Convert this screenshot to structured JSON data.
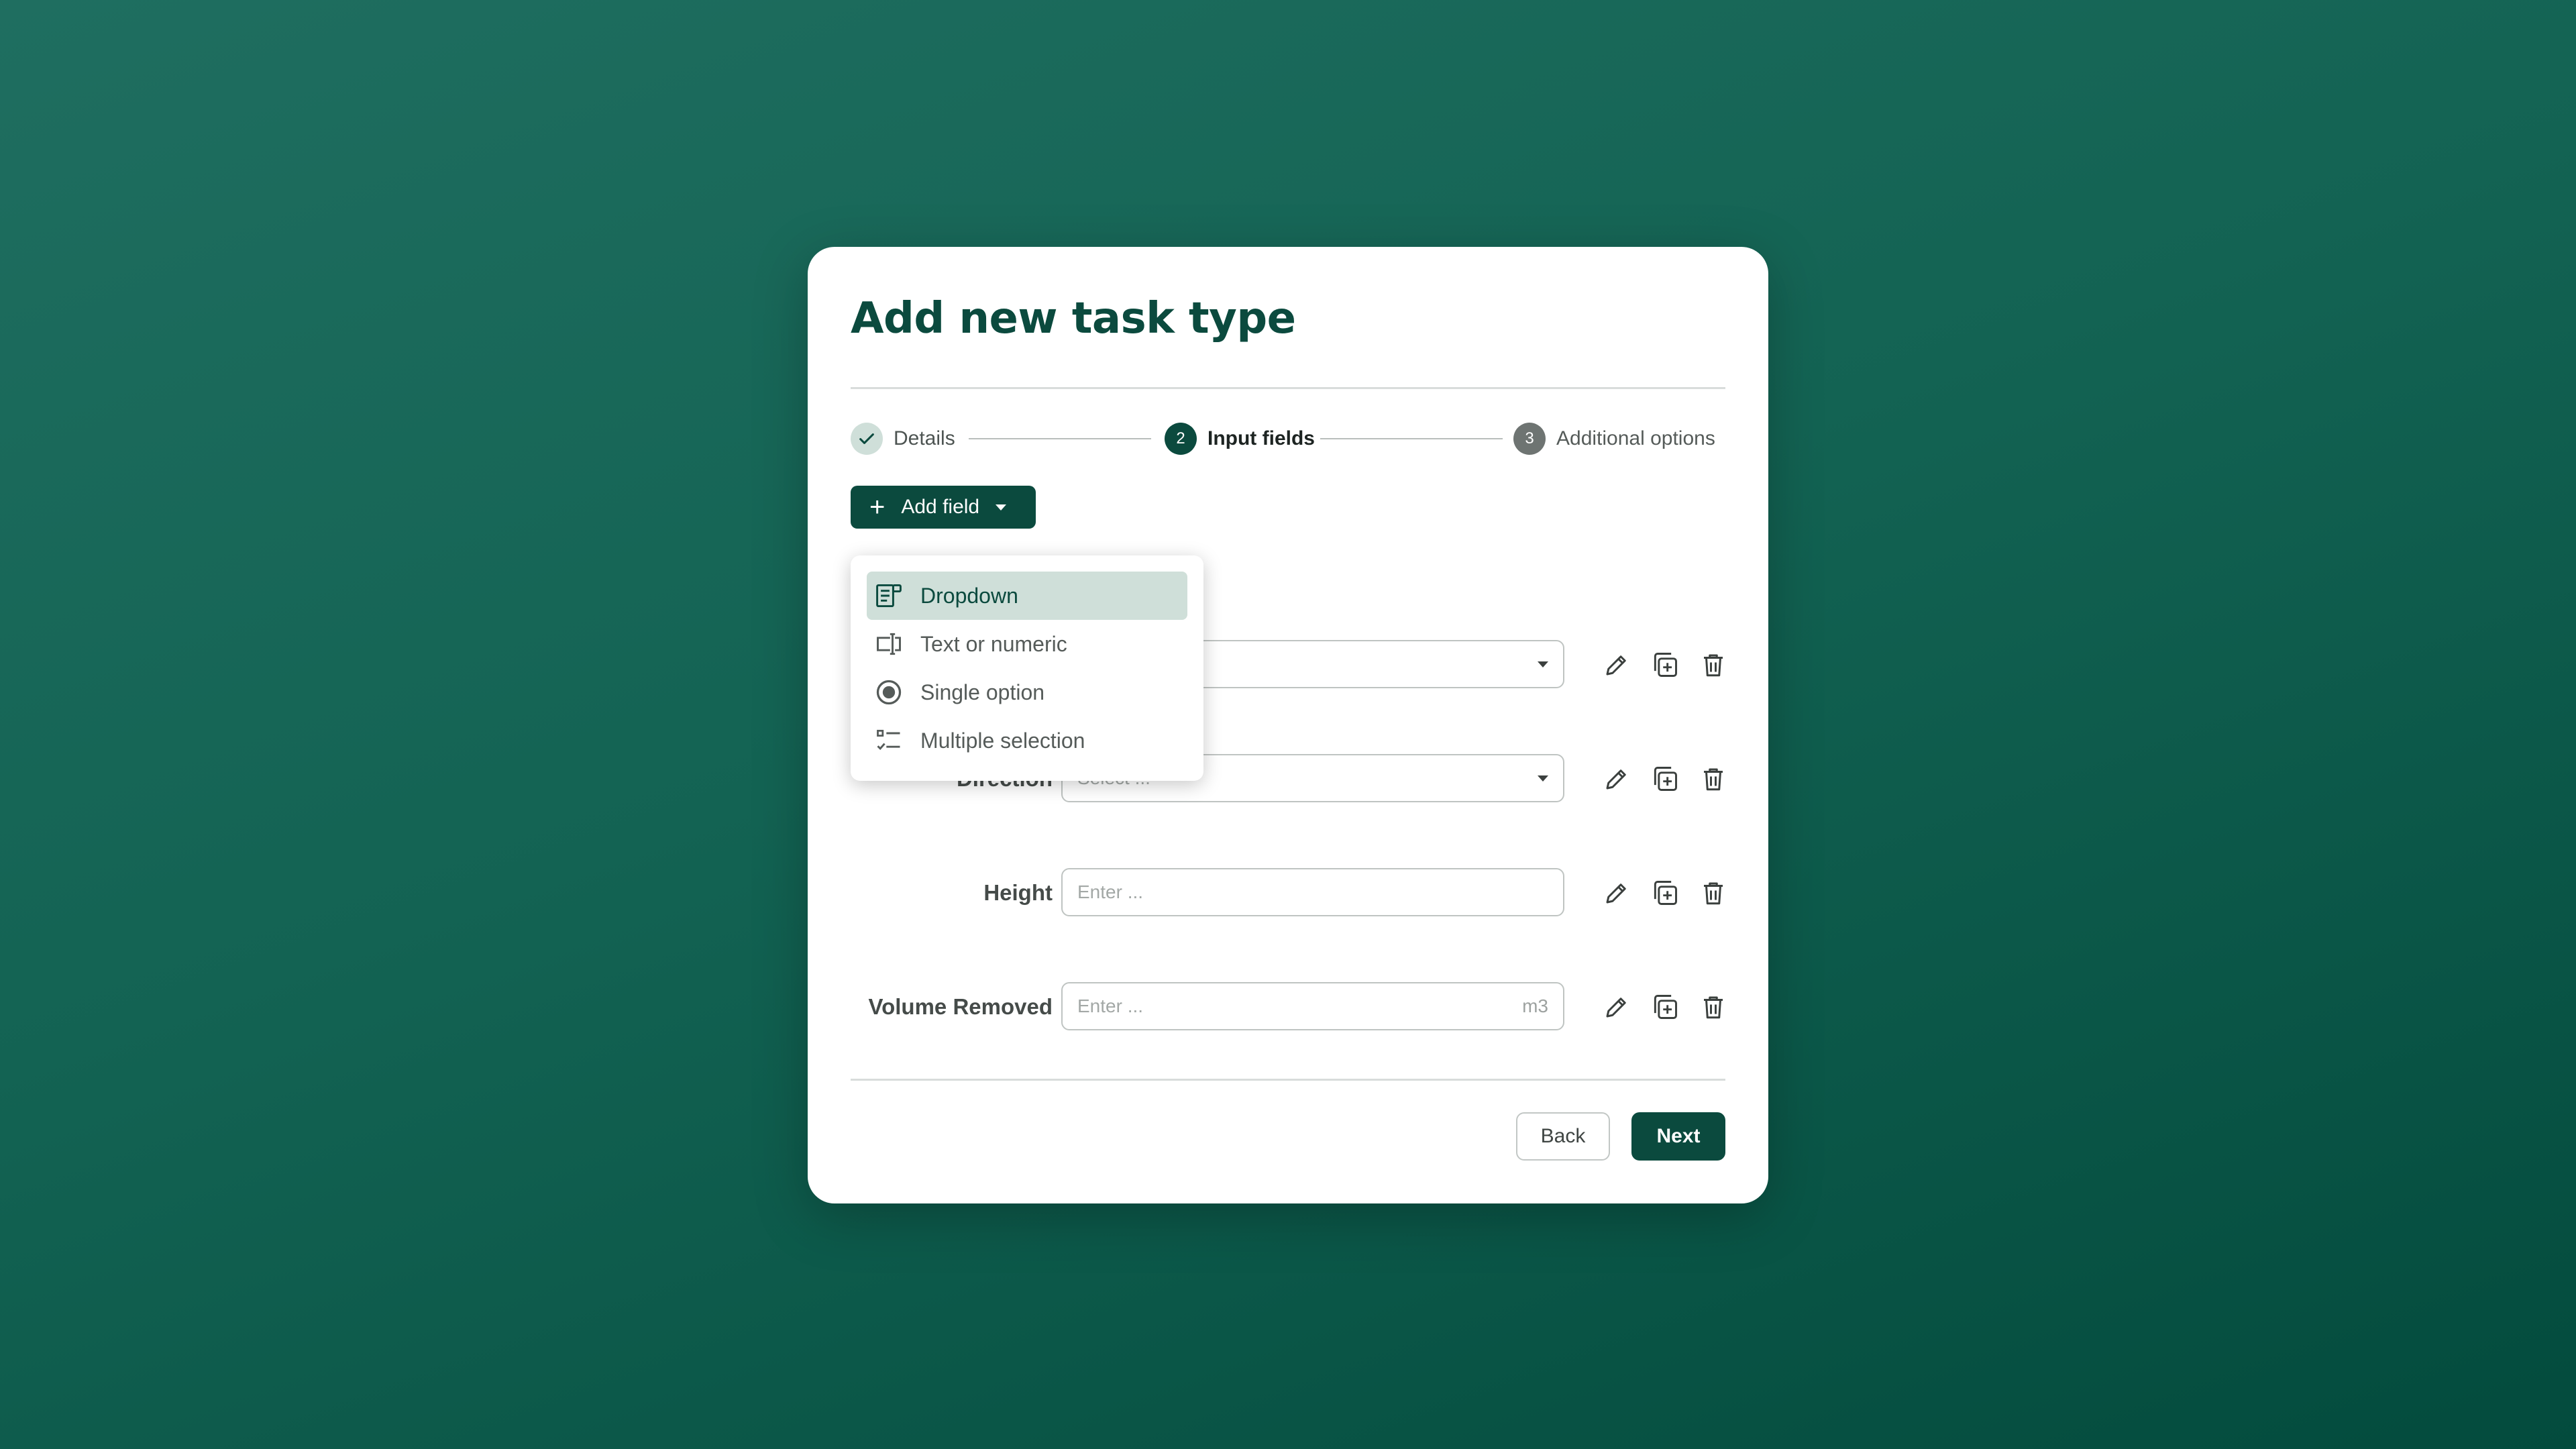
{
  "modal": {
    "title": "Add new task type"
  },
  "stepper": {
    "steps": [
      {
        "number": "",
        "label": "Details",
        "state": "done"
      },
      {
        "number": "2",
        "label": "Input fields",
        "state": "active"
      },
      {
        "number": "3",
        "label": "Additional options",
        "state": "pending"
      }
    ]
  },
  "toolbar": {
    "add_field_label": "Add field",
    "add_icon": "plus-icon",
    "caret_icon": "chevron-down-icon"
  },
  "menu": {
    "items": [
      {
        "label": "Dropdown",
        "icon": "dropdown-field-icon",
        "selected": true
      },
      {
        "label": "Text or numeric",
        "icon": "text-field-icon",
        "selected": false
      },
      {
        "label": "Single option",
        "icon": "radio-icon",
        "selected": false
      },
      {
        "label": "Multiple selection",
        "icon": "checklist-icon",
        "selected": false
      }
    ]
  },
  "fields": [
    {
      "label": "",
      "type": "dropdown",
      "placeholder": "",
      "unit": ""
    },
    {
      "label": "Direction",
      "type": "dropdown",
      "placeholder": "Select ...",
      "unit": ""
    },
    {
      "label": "Height",
      "type": "text",
      "placeholder": "Enter ...",
      "unit": ""
    },
    {
      "label": "Volume Removed",
      "type": "text",
      "placeholder": "Enter ...",
      "unit": "m3"
    }
  ],
  "row_actions": {
    "edit_icon": "pencil-icon",
    "duplicate_icon": "duplicate-icon",
    "delete_icon": "trash-icon"
  },
  "footer": {
    "back_label": "Back",
    "next_label": "Next"
  },
  "colors": {
    "brand": "#0b4a3e",
    "selected_bg": "#cfdfd9",
    "background": "#136353"
  }
}
